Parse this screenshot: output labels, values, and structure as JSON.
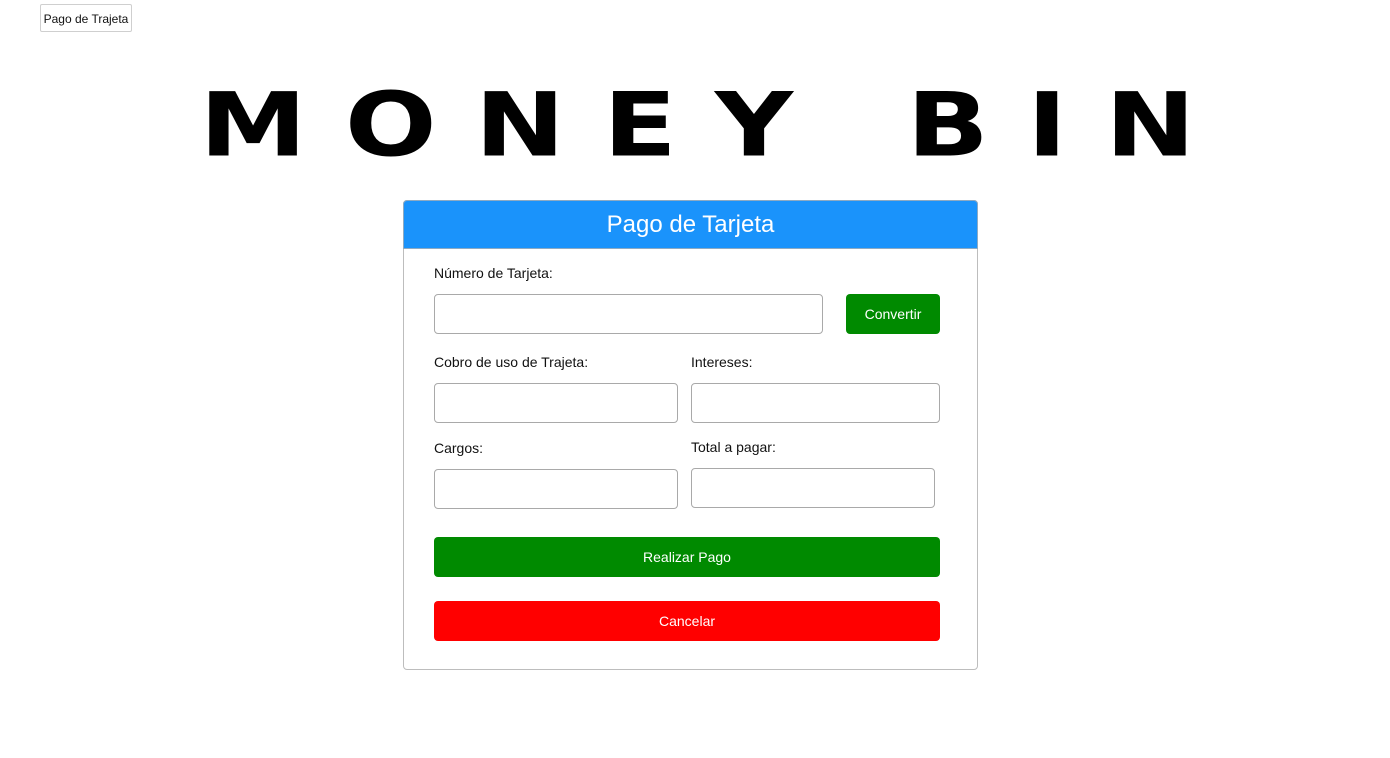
{
  "nav": {
    "tab_label": "Pago de Trajeta"
  },
  "logo": {
    "text": "MONEY BIN"
  },
  "form": {
    "title": "Pago de Tarjeta",
    "card_number_label": "Número de Tarjeta:",
    "card_number_value": "",
    "convert_button": "Convertir",
    "usage_fee_label": "Cobro de uso de Trajeta:",
    "usage_fee_value": "",
    "interest_label": "Intereses:",
    "interest_value": "",
    "charges_label": "Cargos:",
    "charges_value": "",
    "total_label": "Total a pagar:",
    "total_value": "",
    "pay_button": "Realizar Pago",
    "cancel_button": "Cancelar"
  },
  "colors": {
    "header_blue": "#1a93fb",
    "pay_green": "#008a00",
    "cancel_red": "#ff0000"
  }
}
